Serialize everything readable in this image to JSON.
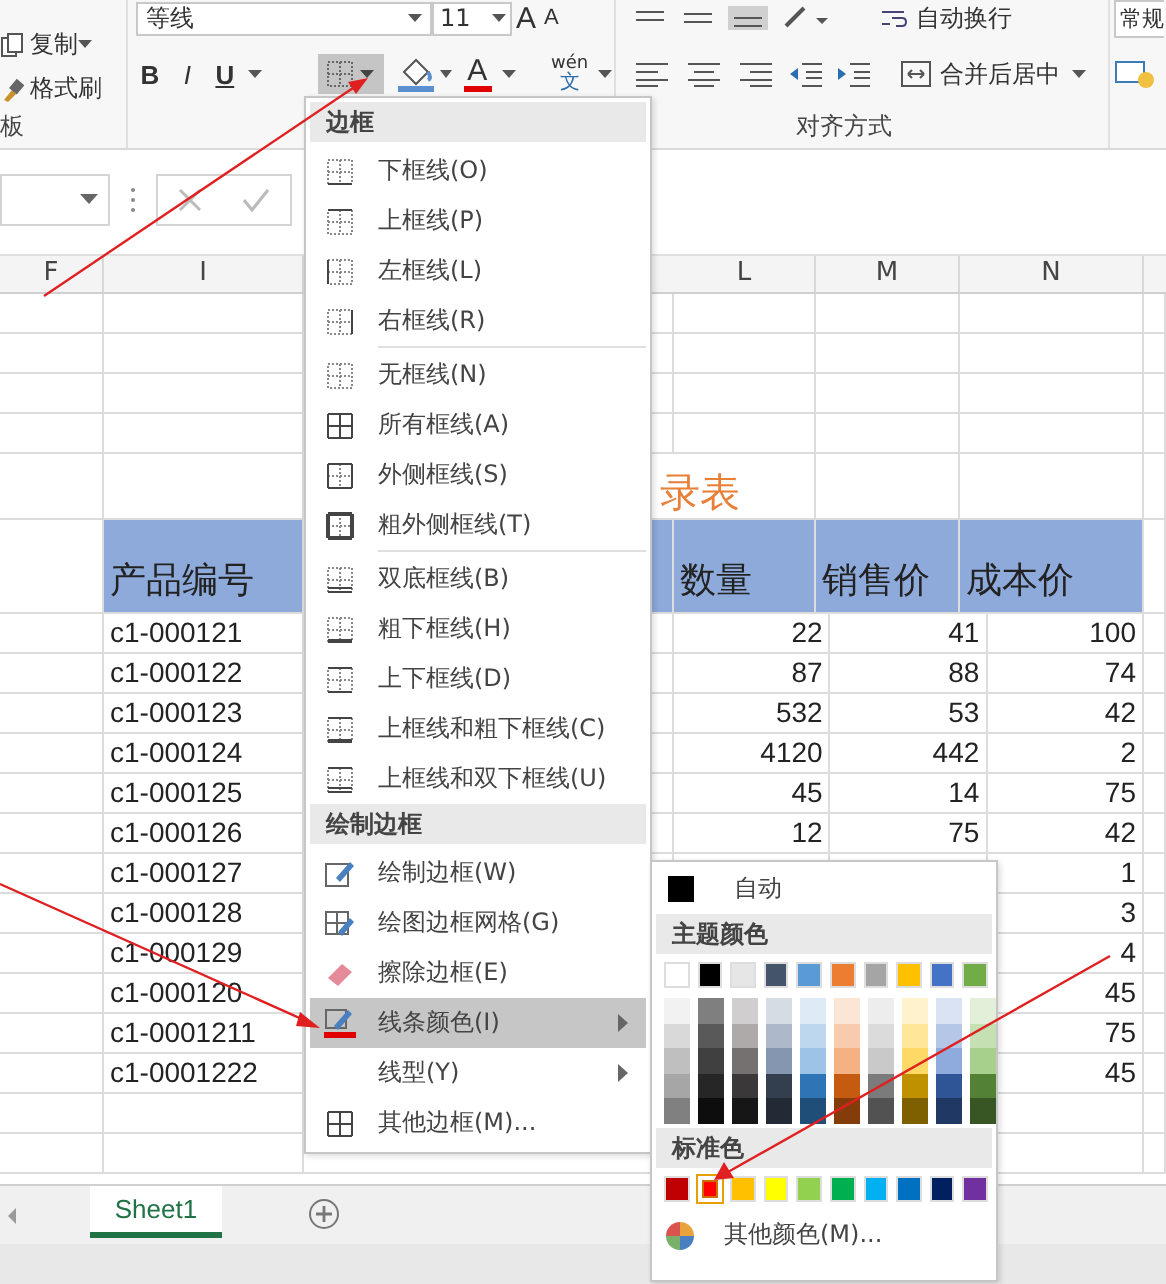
{
  "ribbon": {
    "clipboard": {
      "copy": "复制",
      "format_painter": "格式刷",
      "group_label": "板"
    },
    "font": {
      "font_name": "等线",
      "font_size": "11",
      "grow": "A",
      "shrink": "A",
      "font_color": "A",
      "bold": "B",
      "italic": "I",
      "underline": "U",
      "phonetic_top": "wén",
      "phonetic_bottom": "文"
    },
    "alignment": {
      "wrap_text": "自动换行",
      "merge_center": "合并后居中",
      "group_label": "对齐方式"
    },
    "number": {
      "format": "常规"
    }
  },
  "columns": [
    "F",
    "I",
    "L",
    "M",
    "N"
  ],
  "sheet": {
    "title_fragment": "录表",
    "headers": [
      "产品编号",
      "数量",
      "销售价",
      "成本价"
    ],
    "rows": [
      {
        "code": "c1-000121",
        "qty": "22",
        "price": "41",
        "cost": "100"
      },
      {
        "code": "c1-000122",
        "qty": "87",
        "price": "88",
        "cost": "74"
      },
      {
        "code": "c1-000123",
        "qty": "532",
        "price": "53",
        "cost": "42"
      },
      {
        "code": "c1-000124",
        "qty": "4120",
        "price": "442",
        "cost": "2"
      },
      {
        "code": "c1-000125",
        "qty": "45",
        "price": "14",
        "cost": "75"
      },
      {
        "code": "c1-000126",
        "qty": "12",
        "price": "75",
        "cost": "42"
      },
      {
        "code": "c1-000127",
        "cost": "1"
      },
      {
        "code": "c1-000128",
        "cost": "3"
      },
      {
        "code": "c1-000129",
        "cost": "4"
      },
      {
        "code": "c1-000120",
        "cost": "45"
      },
      {
        "code": "c1-0001211",
        "cost": "75"
      },
      {
        "code": "c1-0001222",
        "cost": "45"
      }
    ]
  },
  "border_menu": {
    "groups": [
      {
        "header": "边框",
        "sections": [
          [
            {
              "label": "下框线(O)",
              "highlighted": false,
              "submenu": false
            },
            {
              "label": "上框线(P)",
              "highlighted": false,
              "submenu": false
            },
            {
              "label": "左框线(L)",
              "highlighted": false,
              "submenu": false
            },
            {
              "label": "右框线(R)",
              "highlighted": false,
              "submenu": false
            }
          ],
          [
            {
              "label": "无框线(N)",
              "highlighted": false,
              "submenu": false
            },
            {
              "label": "所有框线(A)",
              "highlighted": false,
              "submenu": false
            },
            {
              "label": "外侧框线(S)",
              "highlighted": false,
              "submenu": false
            },
            {
              "label": "粗外侧框线(T)",
              "highlighted": false,
              "submenu": false
            }
          ],
          [
            {
              "label": "双底框线(B)",
              "highlighted": false,
              "submenu": false
            },
            {
              "label": "粗下框线(H)",
              "highlighted": false,
              "submenu": false
            },
            {
              "label": "上下框线(D)",
              "highlighted": false,
              "submenu": false
            },
            {
              "label": "上框线和粗下框线(C)",
              "highlighted": false,
              "submenu": false
            },
            {
              "label": "上框线和双下框线(U)",
              "highlighted": false,
              "submenu": false
            }
          ]
        ]
      },
      {
        "header": "绘制边框",
        "sections": [
          [
            {
              "label": "绘制边框(W)",
              "highlighted": false,
              "submenu": false
            },
            {
              "label": "绘图边框网格(G)",
              "highlighted": false,
              "submenu": false
            },
            {
              "label": "擦除边框(E)",
              "highlighted": false,
              "submenu": false
            },
            {
              "label": "线条颜色(I)",
              "highlighted": true,
              "submenu": true
            },
            {
              "label": "线型(Y)",
              "highlighted": false,
              "submenu": true
            },
            {
              "label": "其他边框(M)...",
              "highlighted": false,
              "submenu": false
            }
          ]
        ]
      }
    ]
  },
  "color_menu": {
    "auto": {
      "label": "自动",
      "color": "#000000"
    },
    "theme_header": "主题颜色",
    "theme": [
      {
        "color": "#ffffff",
        "shades": [
          {
            "color": "#f2f2f2"
          },
          {
            "color": "#d9d9d9"
          },
          {
            "color": "#bfbfbf"
          },
          {
            "color": "#a6a6a6"
          },
          {
            "color": "#808080"
          }
        ]
      },
      {
        "color": "#000000",
        "shades": [
          {
            "color": "#7f7f7f"
          },
          {
            "color": "#595959"
          },
          {
            "color": "#404040"
          },
          {
            "color": "#262626"
          },
          {
            "color": "#0d0d0d"
          }
        ]
      },
      {
        "color": "#e7e6e6",
        "shades": [
          {
            "color": "#d0cece"
          },
          {
            "color": "#aeaaaa"
          },
          {
            "color": "#757171"
          },
          {
            "color": "#3a3838"
          },
          {
            "color": "#171616"
          }
        ]
      },
      {
        "color": "#44546a",
        "shades": [
          {
            "color": "#d6dce4"
          },
          {
            "color": "#adb9ca"
          },
          {
            "color": "#8496b0"
          },
          {
            "color": "#333f4f"
          },
          {
            "color": "#222a35"
          }
        ]
      },
      {
        "color": "#5b9bd5",
        "shades": [
          {
            "color": "#deebf6"
          },
          {
            "color": "#bdd7ee"
          },
          {
            "color": "#9dc3e6"
          },
          {
            "color": "#2e75b5"
          },
          {
            "color": "#1f4e79"
          }
        ]
      },
      {
        "color": "#ed7d31",
        "shades": [
          {
            "color": "#fbe5d5"
          },
          {
            "color": "#f7cbac"
          },
          {
            "color": "#f4b183"
          },
          {
            "color": "#c55a11"
          },
          {
            "color": "#843c0b"
          }
        ]
      },
      {
        "color": "#a5a5a5",
        "shades": [
          {
            "color": "#ededed"
          },
          {
            "color": "#dbdbdb"
          },
          {
            "color": "#c9c9c9"
          },
          {
            "color": "#7b7b7b"
          },
          {
            "color": "#525252"
          }
        ]
      },
      {
        "color": "#ffc000",
        "shades": [
          {
            "color": "#fff2cc"
          },
          {
            "color": "#ffe699"
          },
          {
            "color": "#ffd966"
          },
          {
            "color": "#bf9000"
          },
          {
            "color": "#7f6000"
          }
        ]
      },
      {
        "color": "#4472c4",
        "shades": [
          {
            "color": "#dae3f3"
          },
          {
            "color": "#b4c7e7"
          },
          {
            "color": "#8faadc"
          },
          {
            "color": "#2f5597"
          },
          {
            "color": "#1f3864"
          }
        ]
      },
      {
        "color": "#70ad47",
        "shades": [
          {
            "color": "#e2efd9"
          },
          {
            "color": "#c5e0b3"
          },
          {
            "color": "#a8d08d"
          },
          {
            "color": "#538135"
          },
          {
            "color": "#375623"
          }
        ]
      }
    ],
    "standard_header": "标准色",
    "standard": [
      {
        "color": "#c00000",
        "selected": false
      },
      {
        "color": "#ff0000",
        "selected": true
      },
      {
        "color": "#ffc000",
        "selected": false
      },
      {
        "color": "#ffff00",
        "selected": false
      },
      {
        "color": "#92d050",
        "selected": false
      },
      {
        "color": "#00b050",
        "selected": false
      },
      {
        "color": "#00b0f0",
        "selected": false
      },
      {
        "color": "#0070c0",
        "selected": false
      },
      {
        "color": "#002060",
        "selected": false
      },
      {
        "color": "#7030a0",
        "selected": false
      }
    ],
    "more": "其他颜色(M)..."
  },
  "sheet_tabs": [
    {
      "label": "Sheet1",
      "selected": true
    }
  ]
}
